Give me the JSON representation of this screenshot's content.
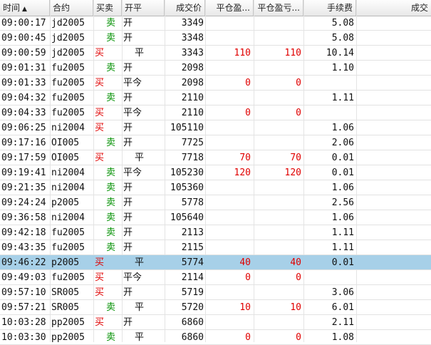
{
  "headers": {
    "time": "时间",
    "contract": "合约",
    "direction": "买卖",
    "offset": "开平",
    "price": "成交价",
    "close_profit": "平仓盈...",
    "close_pnl": "平仓盈亏...",
    "fee": "手续费",
    "volume": "成交"
  },
  "sort_icon": "▲",
  "rows": [
    {
      "time": "09:00:17",
      "contract": "jd2005",
      "dir": "卖",
      "offset": "开",
      "price": "3349",
      "p1": "",
      "p2": "",
      "fee": "5.08"
    },
    {
      "time": "09:00:45",
      "contract": "jd2005",
      "dir": "卖",
      "offset": "开",
      "price": "3348",
      "p1": "",
      "p2": "",
      "fee": "5.08"
    },
    {
      "time": "09:00:59",
      "contract": "jd2005",
      "dir": "买",
      "offset": "平",
      "price": "3343",
      "p1": "110",
      "p2": "110",
      "fee": "10.14"
    },
    {
      "time": "09:01:31",
      "contract": "fu2005",
      "dir": "卖",
      "offset": "开",
      "price": "2098",
      "p1": "",
      "p2": "",
      "fee": "1.10"
    },
    {
      "time": "09:01:33",
      "contract": "fu2005",
      "dir": "买",
      "offset": "平今",
      "price": "2098",
      "p1": "0",
      "p2": "0",
      "fee": ""
    },
    {
      "time": "09:04:32",
      "contract": "fu2005",
      "dir": "卖",
      "offset": "开",
      "price": "2110",
      "p1": "",
      "p2": "",
      "fee": "1.11"
    },
    {
      "time": "09:04:33",
      "contract": "fu2005",
      "dir": "买",
      "offset": "平今",
      "price": "2110",
      "p1": "0",
      "p2": "0",
      "fee": ""
    },
    {
      "time": "09:06:25",
      "contract": "ni2004",
      "dir": "买",
      "offset": "开",
      "price": "105110",
      "p1": "",
      "p2": "",
      "fee": "1.06"
    },
    {
      "time": "09:17:16",
      "contract": "OI005",
      "dir": "卖",
      "offset": "开",
      "price": "7725",
      "p1": "",
      "p2": "",
      "fee": "2.06"
    },
    {
      "time": "09:17:59",
      "contract": "OI005",
      "dir": "买",
      "offset": "平",
      "price": "7718",
      "p1": "70",
      "p2": "70",
      "fee": "0.01"
    },
    {
      "time": "09:19:41",
      "contract": "ni2004",
      "dir": "卖",
      "offset": "平今",
      "price": "105230",
      "p1": "120",
      "p2": "120",
      "fee": "0.01"
    },
    {
      "time": "09:21:35",
      "contract": "ni2004",
      "dir": "卖",
      "offset": "开",
      "price": "105360",
      "p1": "",
      "p2": "",
      "fee": "1.06"
    },
    {
      "time": "09:24:24",
      "contract": "p2005",
      "dir": "卖",
      "offset": "开",
      "price": "5778",
      "p1": "",
      "p2": "",
      "fee": "2.56"
    },
    {
      "time": "09:36:58",
      "contract": "ni2004",
      "dir": "卖",
      "offset": "开",
      "price": "105640",
      "p1": "",
      "p2": "",
      "fee": "1.06"
    },
    {
      "time": "09:42:18",
      "contract": "fu2005",
      "dir": "卖",
      "offset": "开",
      "price": "2113",
      "p1": "",
      "p2": "",
      "fee": "1.11"
    },
    {
      "time": "09:43:35",
      "contract": "fu2005",
      "dir": "卖",
      "offset": "开",
      "price": "2115",
      "p1": "",
      "p2": "",
      "fee": "1.11"
    },
    {
      "time": "09:46:22",
      "contract": "p2005",
      "dir": "买",
      "offset": "平",
      "price": "5774",
      "p1": "40",
      "p2": "40",
      "fee": "0.01",
      "selected": true
    },
    {
      "time": "09:49:03",
      "contract": "fu2005",
      "dir": "买",
      "offset": "平今",
      "price": "2114",
      "p1": "0",
      "p2": "0",
      "fee": ""
    },
    {
      "time": "09:57:10",
      "contract": "SR005",
      "dir": "买",
      "offset": "开",
      "price": "5719",
      "p1": "",
      "p2": "",
      "fee": "3.06"
    },
    {
      "time": "09:57:21",
      "contract": "SR005",
      "dir": "卖",
      "offset": "平",
      "price": "5720",
      "p1": "10",
      "p2": "10",
      "fee": "6.01"
    },
    {
      "time": "10:03:28",
      "contract": "pp2005",
      "dir": "买",
      "offset": "开",
      "price": "6860",
      "p1": "",
      "p2": "",
      "fee": "2.11"
    },
    {
      "time": "10:03:30",
      "contract": "pp2005",
      "dir": "卖",
      "offset": "平",
      "price": "6860",
      "p1": "0",
      "p2": "0",
      "fee": "1.08"
    }
  ],
  "colors": {
    "buy": "#e00000",
    "sell": "#009000",
    "selected": "#a7d0e8"
  }
}
